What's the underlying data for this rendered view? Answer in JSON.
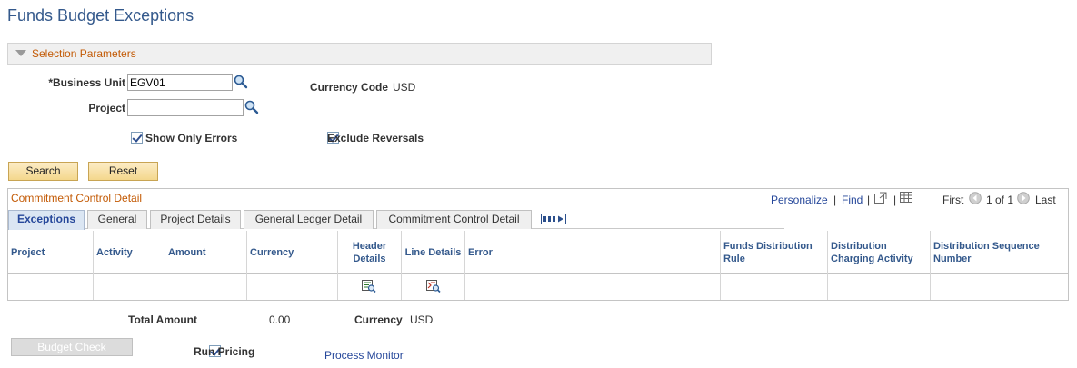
{
  "page": {
    "title": "Funds Budget Exceptions"
  },
  "selection": {
    "section_label": "Selection Parameters",
    "business_unit_label": "*Business Unit",
    "business_unit_value": "EGV01",
    "project_label": "Project",
    "project_value": "",
    "currency_code_label": "Currency Code",
    "currency_code_value": "USD",
    "show_only_errors_label": "Show Only Errors",
    "show_only_errors_checked": true,
    "exclude_reversals_label": "Exclude Reversals",
    "exclude_reversals_checked": true,
    "search_label": "Search",
    "reset_label": "Reset"
  },
  "grid": {
    "caption": "Commitment Control Detail",
    "personalize": "Personalize",
    "find": "Find",
    "first": "First",
    "range": "1 of 1",
    "last": "Last",
    "tabs": [
      {
        "label": "Exceptions",
        "active": true
      },
      {
        "label": "General",
        "active": false
      },
      {
        "label": "Project Details",
        "active": false
      },
      {
        "label": "General Ledger Detail",
        "active": false
      },
      {
        "label": "Commitment Control Detail",
        "active": false
      }
    ],
    "columns": {
      "project": "Project",
      "activity": "Activity",
      "amount": "Amount",
      "currency": "Currency",
      "header_details": "Header Details",
      "line_details": "Line Details",
      "error": "Error",
      "funds_distribution_rule": "Funds Distribution Rule",
      "distribution_charging_activity": "Distribution Charging Activity",
      "distribution_sequence_number": "Distribution Sequence Number"
    }
  },
  "footer": {
    "total_amount_label": "Total Amount",
    "total_amount_value": "0.00",
    "currency_label": "Currency",
    "currency_value": "USD",
    "budget_check_label": "Budget Check",
    "run_pricing_label": "Run Pricing",
    "run_pricing_checked": true,
    "process_monitor_label": "Process Monitor"
  },
  "colors": {
    "title": "#34598c",
    "section_label": "#c35a05",
    "link": "#25479a",
    "button_top": "#fcecc6",
    "button_bottom": "#f4d78c"
  }
}
